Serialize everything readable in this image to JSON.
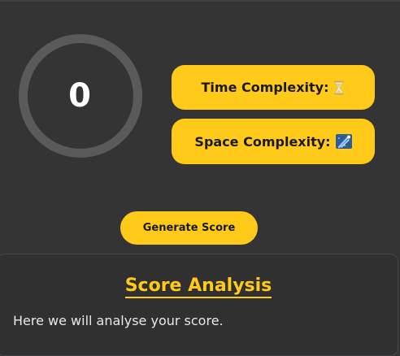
{
  "score": {
    "value": "0"
  },
  "complexity": {
    "time_label": "Time Complexity:",
    "time_icon": "hourglass-icon",
    "space_label": "Space Complexity:",
    "space_icon": "comet-icon"
  },
  "actions": {
    "generate_label": "Generate Score"
  },
  "analysis": {
    "title": "Score Analysis",
    "text": "Here we will analyse your score."
  },
  "colors": {
    "background": "#343434",
    "accent": "#ffca1a",
    "ring": "#5a5a5a",
    "text": "#e8e8e8"
  }
}
